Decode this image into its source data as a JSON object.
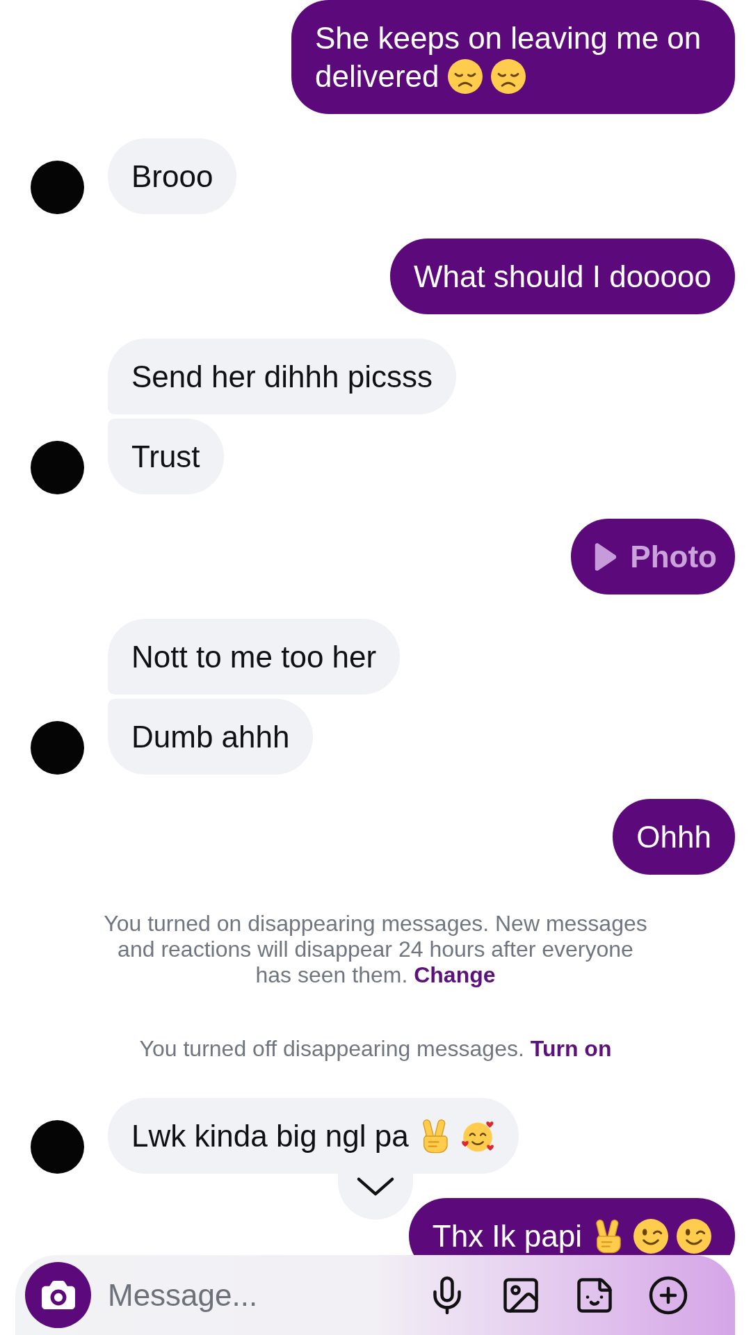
{
  "messages": [
    {
      "kind": "sent",
      "bubbles": [
        {
          "kind": "text",
          "parts": [
            {
              "kind": "text",
              "text": "She keeps on leaving me on delivered"
            },
            {
              "kind": "disappointed"
            },
            {
              "kind": "disappointed"
            }
          ]
        }
      ]
    },
    {
      "kind": "received",
      "bubbles": [
        {
          "kind": "text",
          "parts": [
            {
              "kind": "text",
              "text": "Brooo"
            }
          ]
        }
      ]
    },
    {
      "kind": "sent",
      "bubbles": [
        {
          "kind": "text",
          "parts": [
            {
              "kind": "text",
              "text": "What should I dooooo"
            }
          ]
        }
      ]
    },
    {
      "kind": "received",
      "bubbles": [
        {
          "kind": "text",
          "parts": [
            {
              "kind": "text",
              "text": "Send her dihhh picsss"
            }
          ]
        },
        {
          "kind": "text",
          "parts": [
            {
              "kind": "text",
              "text": "Trust"
            }
          ]
        }
      ]
    },
    {
      "kind": "sent",
      "bubbles": [
        {
          "kind": "photo",
          "label": "Photo"
        }
      ]
    },
    {
      "kind": "received",
      "bubbles": [
        {
          "kind": "text",
          "parts": [
            {
              "kind": "text",
              "text": "Nott to me too her"
            }
          ]
        },
        {
          "kind": "text",
          "parts": [
            {
              "kind": "text",
              "text": "Dumb ahhh"
            }
          ]
        }
      ]
    },
    {
      "kind": "sent",
      "bubbles": [
        {
          "kind": "text",
          "parts": [
            {
              "kind": "text",
              "text": "Ohhh"
            }
          ]
        }
      ]
    },
    {
      "kind": "notice",
      "text": "You turned on disappearing messages. New messages and reactions will disappear 24 hours after everyone has seen them.",
      "link": "Change"
    },
    {
      "kind": "notice",
      "text": "You turned off disappearing messages.",
      "link": "Turn on"
    },
    {
      "kind": "received",
      "bubbles": [
        {
          "kind": "text",
          "parts": [
            {
              "kind": "text",
              "text": "Lwk kinda big ngl pa"
            },
            {
              "kind": "victory"
            },
            {
              "kind": "lovestruck"
            }
          ]
        }
      ]
    },
    {
      "kind": "sent",
      "bubbles": [
        {
          "kind": "text",
          "parts": [
            {
              "kind": "text",
              "text": "Thx Ik papi"
            },
            {
              "kind": "victory"
            },
            {
              "kind": "wink"
            },
            {
              "kind": "wink"
            }
          ]
        }
      ]
    }
  ],
  "composer": {
    "placeholder": "Message..."
  }
}
